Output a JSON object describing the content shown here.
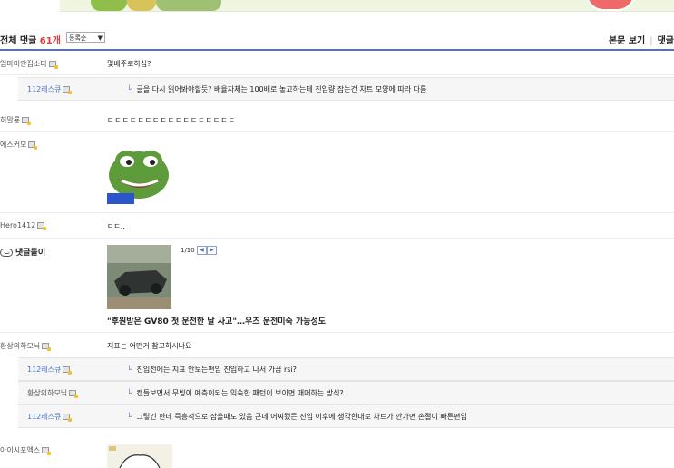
{
  "header": {
    "total_label": "전체 댓글",
    "total_count": "61개",
    "sort_value": "등록순",
    "view_post": "본문 보기",
    "comments_link": "댓글"
  },
  "comments": [
    {
      "author": "엄마미안집소디",
      "text": "몇배주로하심?"
    },
    {
      "author": "112레스큐",
      "text": "글을 다시 읽어봐야할듯? 배율자체는 100배로 놓고하는데 진입량 잡는건 차트 모양에 따라 다름"
    },
    {
      "author": "히말룡",
      "text": "ㄷㄷㄷㄷㄷㄷㄷㄷㄷㄷㄷㄷㄷㄷㄷㄷㄷ"
    },
    {
      "author": "에스커모"
    },
    {
      "author": "Hero1412",
      "text": "ㄷㄷ.."
    },
    {
      "author": "댓글돌이",
      "pager": "1/10",
      "news_title": "\"후원받은 GV80 첫 운전한 날 사고\"…우즈 운전미숙 가능성도"
    },
    {
      "author": "환상의하모닉",
      "text": "지표는 어떤거 참고하시나요"
    },
    {
      "author": "112레스큐",
      "text": "진입전에는 지표 안보는편임 진입하고 나서 가끔 rsi?"
    },
    {
      "author": "환상의하모닉",
      "text": "캔들보면서 무빙이 예측이되는 익숙한 패턴이 보이면 매매하는 방식?"
    },
    {
      "author": "112레스큐",
      "text": "그렇긴 한데 즉흥적으로 잡을때도 있음 근데 어찌됐든 진입 이후에 생각한대로 차트가 안가면 손절이 빠른편임"
    },
    {
      "author": "아이시포엑스"
    }
  ]
}
